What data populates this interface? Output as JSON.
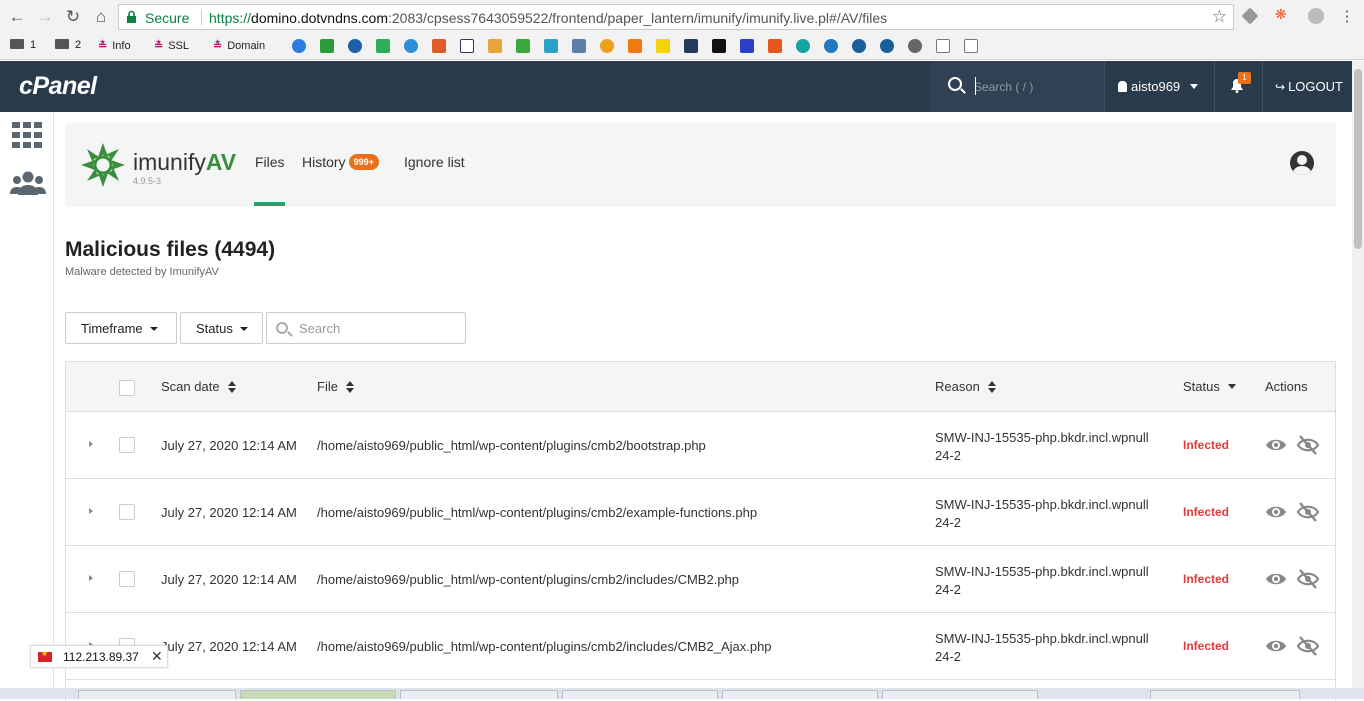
{
  "browser": {
    "secure_label": "Secure",
    "url_scheme": "https://",
    "url_host": "domino.dotvndns.com",
    "url_rest": ":2083/cpsess7643059522/frontend/paper_lantern/imunify/imunify.live.pl#/AV/files",
    "bookmarks": [
      "1",
      "2",
      "Info",
      "SSL",
      "Domain"
    ]
  },
  "cpanel": {
    "logo": "cPanel",
    "search_placeholder": "Search ( / )",
    "username": "aisto969",
    "notification_count": "1",
    "logout_label": "LOGOUT"
  },
  "imunify": {
    "brand_light": "imunify",
    "brand_bold": "AV",
    "version": "4.9.5-3",
    "tabs": {
      "files": "Files",
      "history": "History",
      "history_badge": "999+",
      "ignore": "Ignore list"
    }
  },
  "page": {
    "title": "Malicious files (4494)",
    "subtitle": "Malware detected by ImunifyAV"
  },
  "filters": {
    "timeframe": "Timeframe",
    "status": "Status",
    "search_placeholder": "Search"
  },
  "table": {
    "headers": {
      "scan_date": "Scan date",
      "file": "File",
      "reason": "Reason",
      "status": "Status",
      "actions": "Actions"
    },
    "rows": [
      {
        "date": "July 27, 2020 12:14 AM",
        "file": "/home/aisto969/public_html/wp-content/plugins/cmb2/bootstrap.php",
        "reason": "SMW-INJ-15535-php.bkdr.incl.wpnull 24-2",
        "status": "Infected"
      },
      {
        "date": "July 27, 2020 12:14 AM",
        "file": "/home/aisto969/public_html/wp-content/plugins/cmb2/example-functions.php",
        "reason": "SMW-INJ-15535-php.bkdr.incl.wpnull 24-2",
        "status": "Infected"
      },
      {
        "date": "July 27, 2020 12:14 AM",
        "file": "/home/aisto969/public_html/wp-content/plugins/cmb2/includes/CMB2.php",
        "reason": "SMW-INJ-15535-php.bkdr.incl.wpnull 24-2",
        "status": "Infected"
      },
      {
        "date": "July 27, 2020 12:14 AM",
        "file": "/home/aisto969/public_html/wp-content/plugins/cmb2/includes/CMB2_Ajax.php",
        "reason": "SMW-INJ-15535-php.bkdr.incl.wpnull 24-2",
        "status": "Infected"
      }
    ]
  },
  "ip_toast": {
    "ip": "112.213.89.37"
  },
  "colors": {
    "header_bg": "#293a4a",
    "brand_green": "#3a8f3d",
    "badge_orange": "#e8711a",
    "infected_red": "#e23b3b",
    "active_tab": "#2e9f6b"
  }
}
